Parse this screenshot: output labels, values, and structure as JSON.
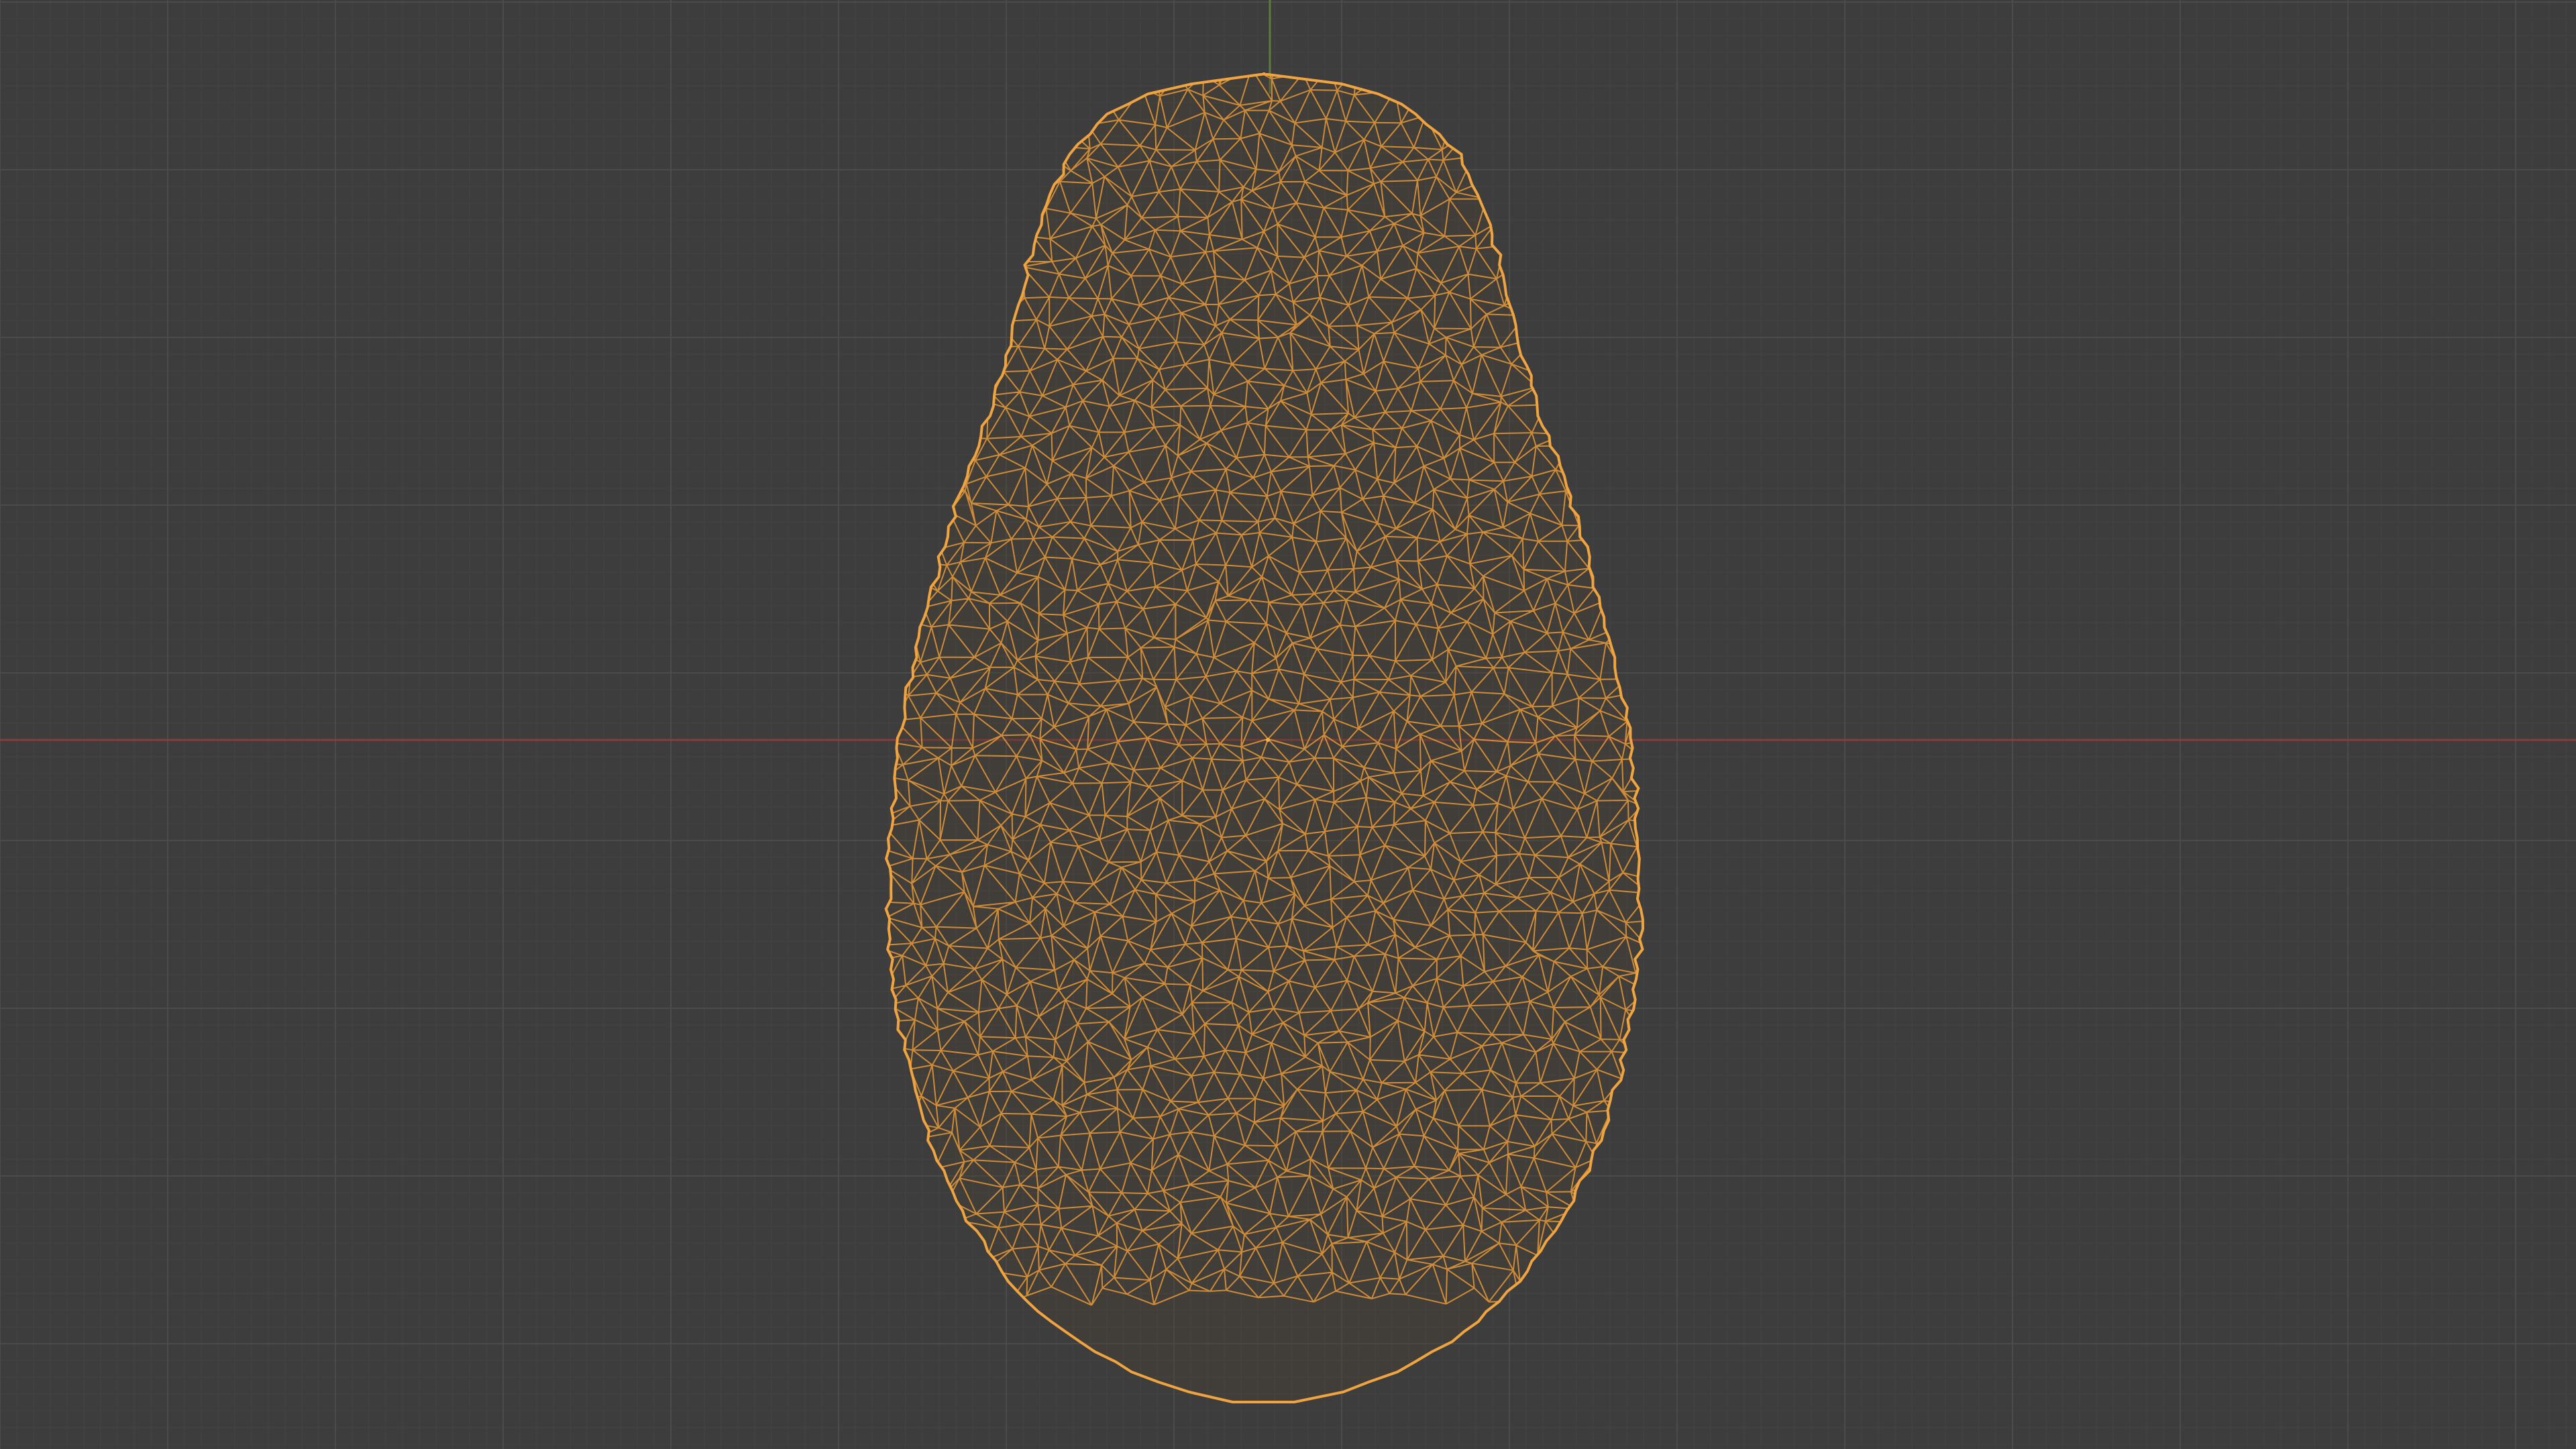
{
  "viewport": {
    "view": "orthographic-wireframe",
    "background_color": "#3d3d3d",
    "grid": {
      "visible": true,
      "minor_color": "#444444",
      "major_color": "#4b4b4b"
    },
    "axes": {
      "x_axis_color": "#8a3b3b",
      "y_axis_color": "#5f7a3a"
    },
    "origin_marker_visible": true,
    "selected_object": {
      "shape": "pear-like scanned mesh",
      "display": "wireframe",
      "wire_color": "#e89a3a",
      "outline_color": "#f0a440"
    }
  }
}
